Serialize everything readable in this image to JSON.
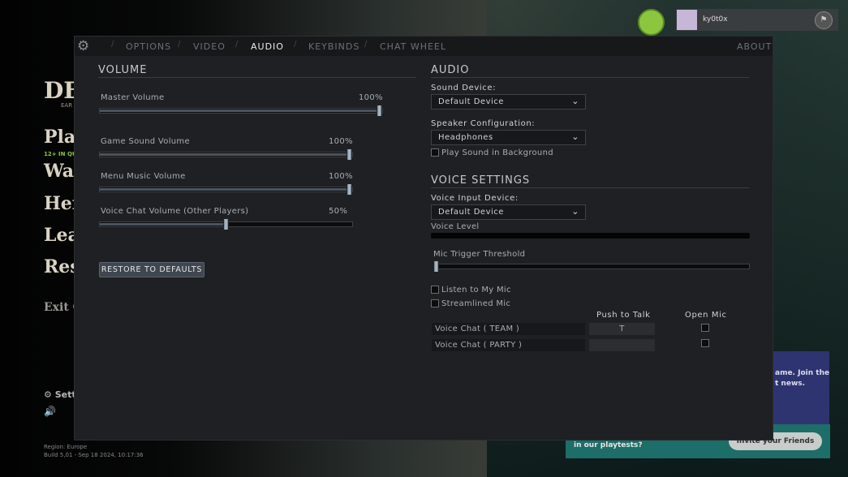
{
  "background": {
    "logo": "DE",
    "logo_sub": "EAR",
    "menu": [
      "Play",
      "Wat",
      "Her",
      "Lear",
      "Res"
    ],
    "play_sub": "12+ IN QU",
    "exit": "Exit G",
    "settings": "Sett",
    "region": "Region: Europe",
    "build": "Build 5,01 - Sep 18 2024, 10:17:36",
    "username": "ky0t0x",
    "promo_text_1": "ame. Join the",
    "promo_text_2": "t news.",
    "playtest_text": "in our playtests?",
    "invite_button": "Invite your Friends"
  },
  "tabs": {
    "items": [
      "OPTIONS",
      "VIDEO",
      "AUDIO",
      "KEYBINDS",
      "CHAT WHEEL"
    ],
    "active": "AUDIO",
    "about": "ABOUT"
  },
  "volume": {
    "title": "VOLUME",
    "sliders": [
      {
        "label": "Master Volume",
        "value": "100%",
        "fraction": 1.0
      },
      {
        "label": "Game Sound Volume",
        "value": "100%",
        "fraction": 1.0
      },
      {
        "label": "Menu Music Volume",
        "value": "100%",
        "fraction": 1.0
      },
      {
        "label": "Voice Chat Volume (Other Players)",
        "value": "50%",
        "fraction": 0.5
      }
    ],
    "restore": "RESTORE TO DEFAULTS"
  },
  "audio": {
    "title": "AUDIO",
    "sound_device_label": "Sound Device:",
    "sound_device": "Default Device",
    "speaker_label": "Speaker Configuration:",
    "speaker": "Headphones",
    "play_bg": "Play Sound in Background",
    "play_bg_checked": false
  },
  "voice": {
    "title": "VOICE SETTINGS",
    "input_label": "Voice Input Device:",
    "input": "Default Device",
    "level_label": "Voice Level",
    "level": 0,
    "threshold_label": "Mic Trigger Threshold",
    "threshold": 0,
    "listen": "Listen to My Mic",
    "streamlined": "Streamlined Mic",
    "col_ptt": "Push to Talk",
    "col_open": "Open Mic",
    "rows": [
      {
        "label": "Voice Chat ( TEAM )",
        "key": "T",
        "open": false
      },
      {
        "label": "Voice Chat ( PARTY )",
        "key": "",
        "open": false
      }
    ]
  },
  "colors": {
    "panel": "#1f2023",
    "accent_green": "#8cc63f"
  }
}
